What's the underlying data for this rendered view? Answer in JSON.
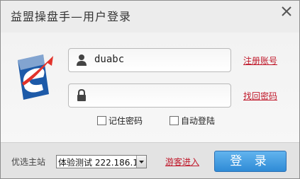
{
  "window": {
    "title": "益盟操盘手—用户登录"
  },
  "login": {
    "username_value": "duabc",
    "password_value": "",
    "register_link": "注册账号",
    "recover_link": "找回密码",
    "remember_password_label": "记住密码",
    "auto_login_label": "自动登陆",
    "remember_password_checked": false,
    "auto_login_checked": false
  },
  "footer": {
    "station_label": "优选主站",
    "station_selected": "体验测试 222.186.1",
    "guest_link": "游客进入",
    "login_button": "登 录"
  },
  "colors": {
    "link": "#c0182a",
    "button": "#3a95dd"
  }
}
